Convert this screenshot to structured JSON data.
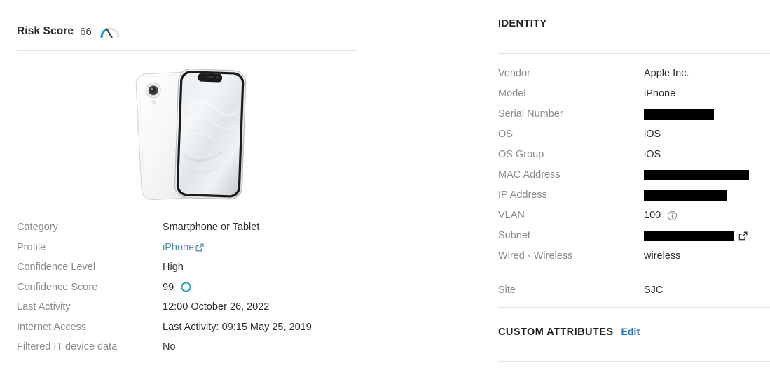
{
  "left": {
    "risk": {
      "label": "Risk Score",
      "value": "66",
      "gauge_icon": "gauge-icon",
      "gauge_arc_color": "#189ee3",
      "gauge_track_color": "#e0e0e0",
      "gauge_needle_color": "#3b3b3b"
    },
    "device_image": {
      "name": "device-photo-iphone-xr",
      "alt": "White iPhone XR shown from back and front"
    },
    "attributes": [
      {
        "label": "Category",
        "value": "Smartphone or Tablet",
        "type": "text"
      },
      {
        "label": "Profile",
        "value": "iPhone",
        "type": "link"
      },
      {
        "label": "Confidence Level",
        "value": "High",
        "type": "text"
      },
      {
        "label": "Confidence Score",
        "value": "99",
        "type": "score"
      },
      {
        "label": "Last Activity",
        "value": "12:00 October 26, 2022",
        "type": "text"
      },
      {
        "label": "Internet Access",
        "value": "Last Activity: 09:15 May 25, 2019",
        "type": "text"
      },
      {
        "label": "Filtered IT device data",
        "value": "No",
        "type": "text"
      }
    ],
    "link_color": "#5b8ca8",
    "confidence_ring_color": "#2ba6bd"
  },
  "right": {
    "identity": {
      "title": "IDENTITY",
      "rows": [
        {
          "label": "Vendor",
          "value": "Apple Inc.",
          "type": "text"
        },
        {
          "label": "Model",
          "value": "iPhone",
          "type": "text"
        },
        {
          "label": "Serial Number",
          "value": "",
          "type": "redacted",
          "redaction_width": 100
        },
        {
          "label": "OS",
          "value": "iOS",
          "type": "text"
        },
        {
          "label": "OS Group",
          "value": "iOS",
          "type": "text"
        },
        {
          "label": "MAC Address",
          "value": "",
          "type": "redacted",
          "redaction_width": 150
        },
        {
          "label": "IP Address",
          "value": "",
          "type": "redacted",
          "redaction_width": 119
        },
        {
          "label": "VLAN",
          "value": "100",
          "type": "info"
        },
        {
          "label": "Subnet",
          "value": "",
          "type": "redacted-link",
          "redaction_width": 128
        },
        {
          "label": "Wired - Wireless",
          "value": "wireless",
          "type": "text"
        }
      ]
    },
    "site": {
      "label": "Site",
      "value": "SJC"
    },
    "custom_attributes": {
      "title": "CUSTOM ATTRIBUTES",
      "edit_label": "Edit",
      "edit_color": "#2a6ebb"
    }
  }
}
